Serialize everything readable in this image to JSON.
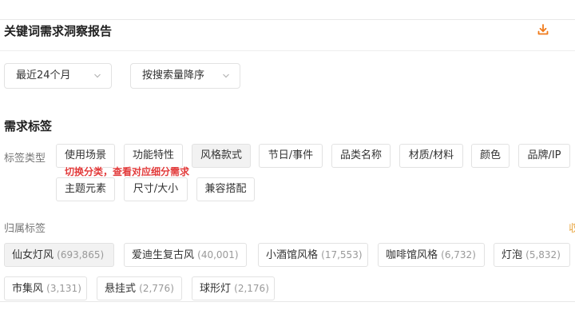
{
  "header": {
    "title": "关键词需求洞察报告",
    "download_icon": "download-icon"
  },
  "filters": {
    "time_range": {
      "value": "最近24个月",
      "icon": "chevron-down-icon"
    },
    "sort": {
      "value": "按搜索量降序",
      "icon": "chevron-down-icon"
    }
  },
  "demand_tags": {
    "section_title": "需求标签",
    "type_label": "标签类型",
    "types": [
      "使用场景",
      "功能特性",
      "风格款式",
      "节日/事件",
      "品类名称",
      "材质/材料",
      "颜色",
      "品牌/IP",
      "主题元素",
      "尺寸/大小",
      "兼容搭配"
    ],
    "selected_type": "风格款式",
    "hint": "切换分类，查看对应细分需求"
  },
  "belong_tags": {
    "label": "归属标签",
    "side_mark": "収",
    "items": [
      {
        "name": "仙女灯风",
        "count": "(693,865)"
      },
      {
        "name": "爱迪生复古风",
        "count": "(40,001)"
      },
      {
        "name": "小酒馆风格",
        "count": "(17,553)"
      },
      {
        "name": "咖啡馆风格",
        "count": "(6,732)"
      },
      {
        "name": "灯泡",
        "count": "(5,832)"
      },
      {
        "name": "市集风",
        "count": "(3,131)"
      },
      {
        "name": "悬挂式",
        "count": "(2,776)"
      },
      {
        "name": "球形灯",
        "count": "(2,176)"
      }
    ]
  },
  "colors": {
    "accent": "#f07a1a",
    "hint_red": "#e23a3a"
  }
}
